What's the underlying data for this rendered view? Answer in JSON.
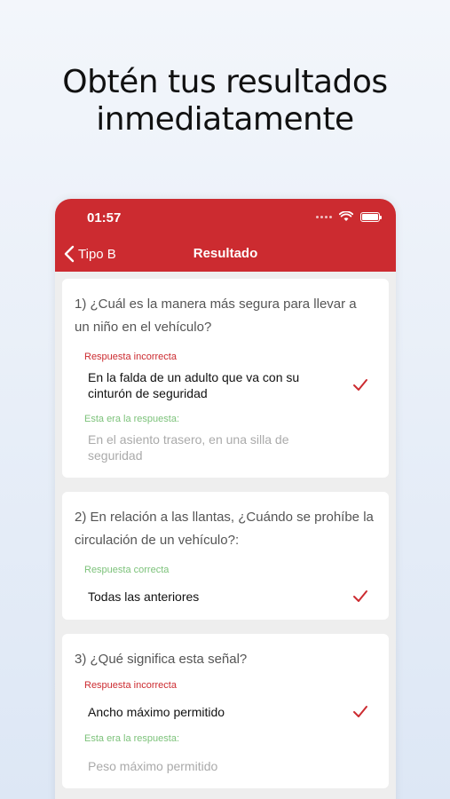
{
  "headline": {
    "line1": "Obtén tus resultados",
    "line2": "inmediatamente"
  },
  "status_bar": {
    "time": "01:57"
  },
  "nav": {
    "back_label": "Tipo B",
    "title": "Resultado"
  },
  "questions": [
    {
      "text": "1) ¿Cuál es la manera más segura para llevar a un niño en el vehículo?",
      "result_label": "Respuesta incorrecta",
      "selected_answer": "En la falda de un adulto que va con su cinturón de seguridad",
      "correct_label": "Esta era la respuesta:",
      "correct_answer": "En el asiento trasero, en una silla de seguridad"
    },
    {
      "text": "2) En relación a las llantas, ¿Cuándo se prohíbe la circulación de un vehículo?:",
      "result_label": "Respuesta correcta",
      "selected_answer": "Todas las anteriores"
    },
    {
      "text": "3) ¿Qué significa esta señal?",
      "result_label": "Respuesta incorrecta",
      "selected_answer": "Ancho máximo permitido",
      "correct_label": "Esta era la respuesta:",
      "correct_answer": "Peso máximo permitido"
    }
  ],
  "colors": {
    "brand_red": "#cc2b30",
    "correct_green": "#7cc27a",
    "muted_gray": "#aaaaaa"
  },
  "icons": [
    "chevron-left-icon",
    "wifi-icon",
    "battery-icon",
    "checkmark-icon"
  ]
}
